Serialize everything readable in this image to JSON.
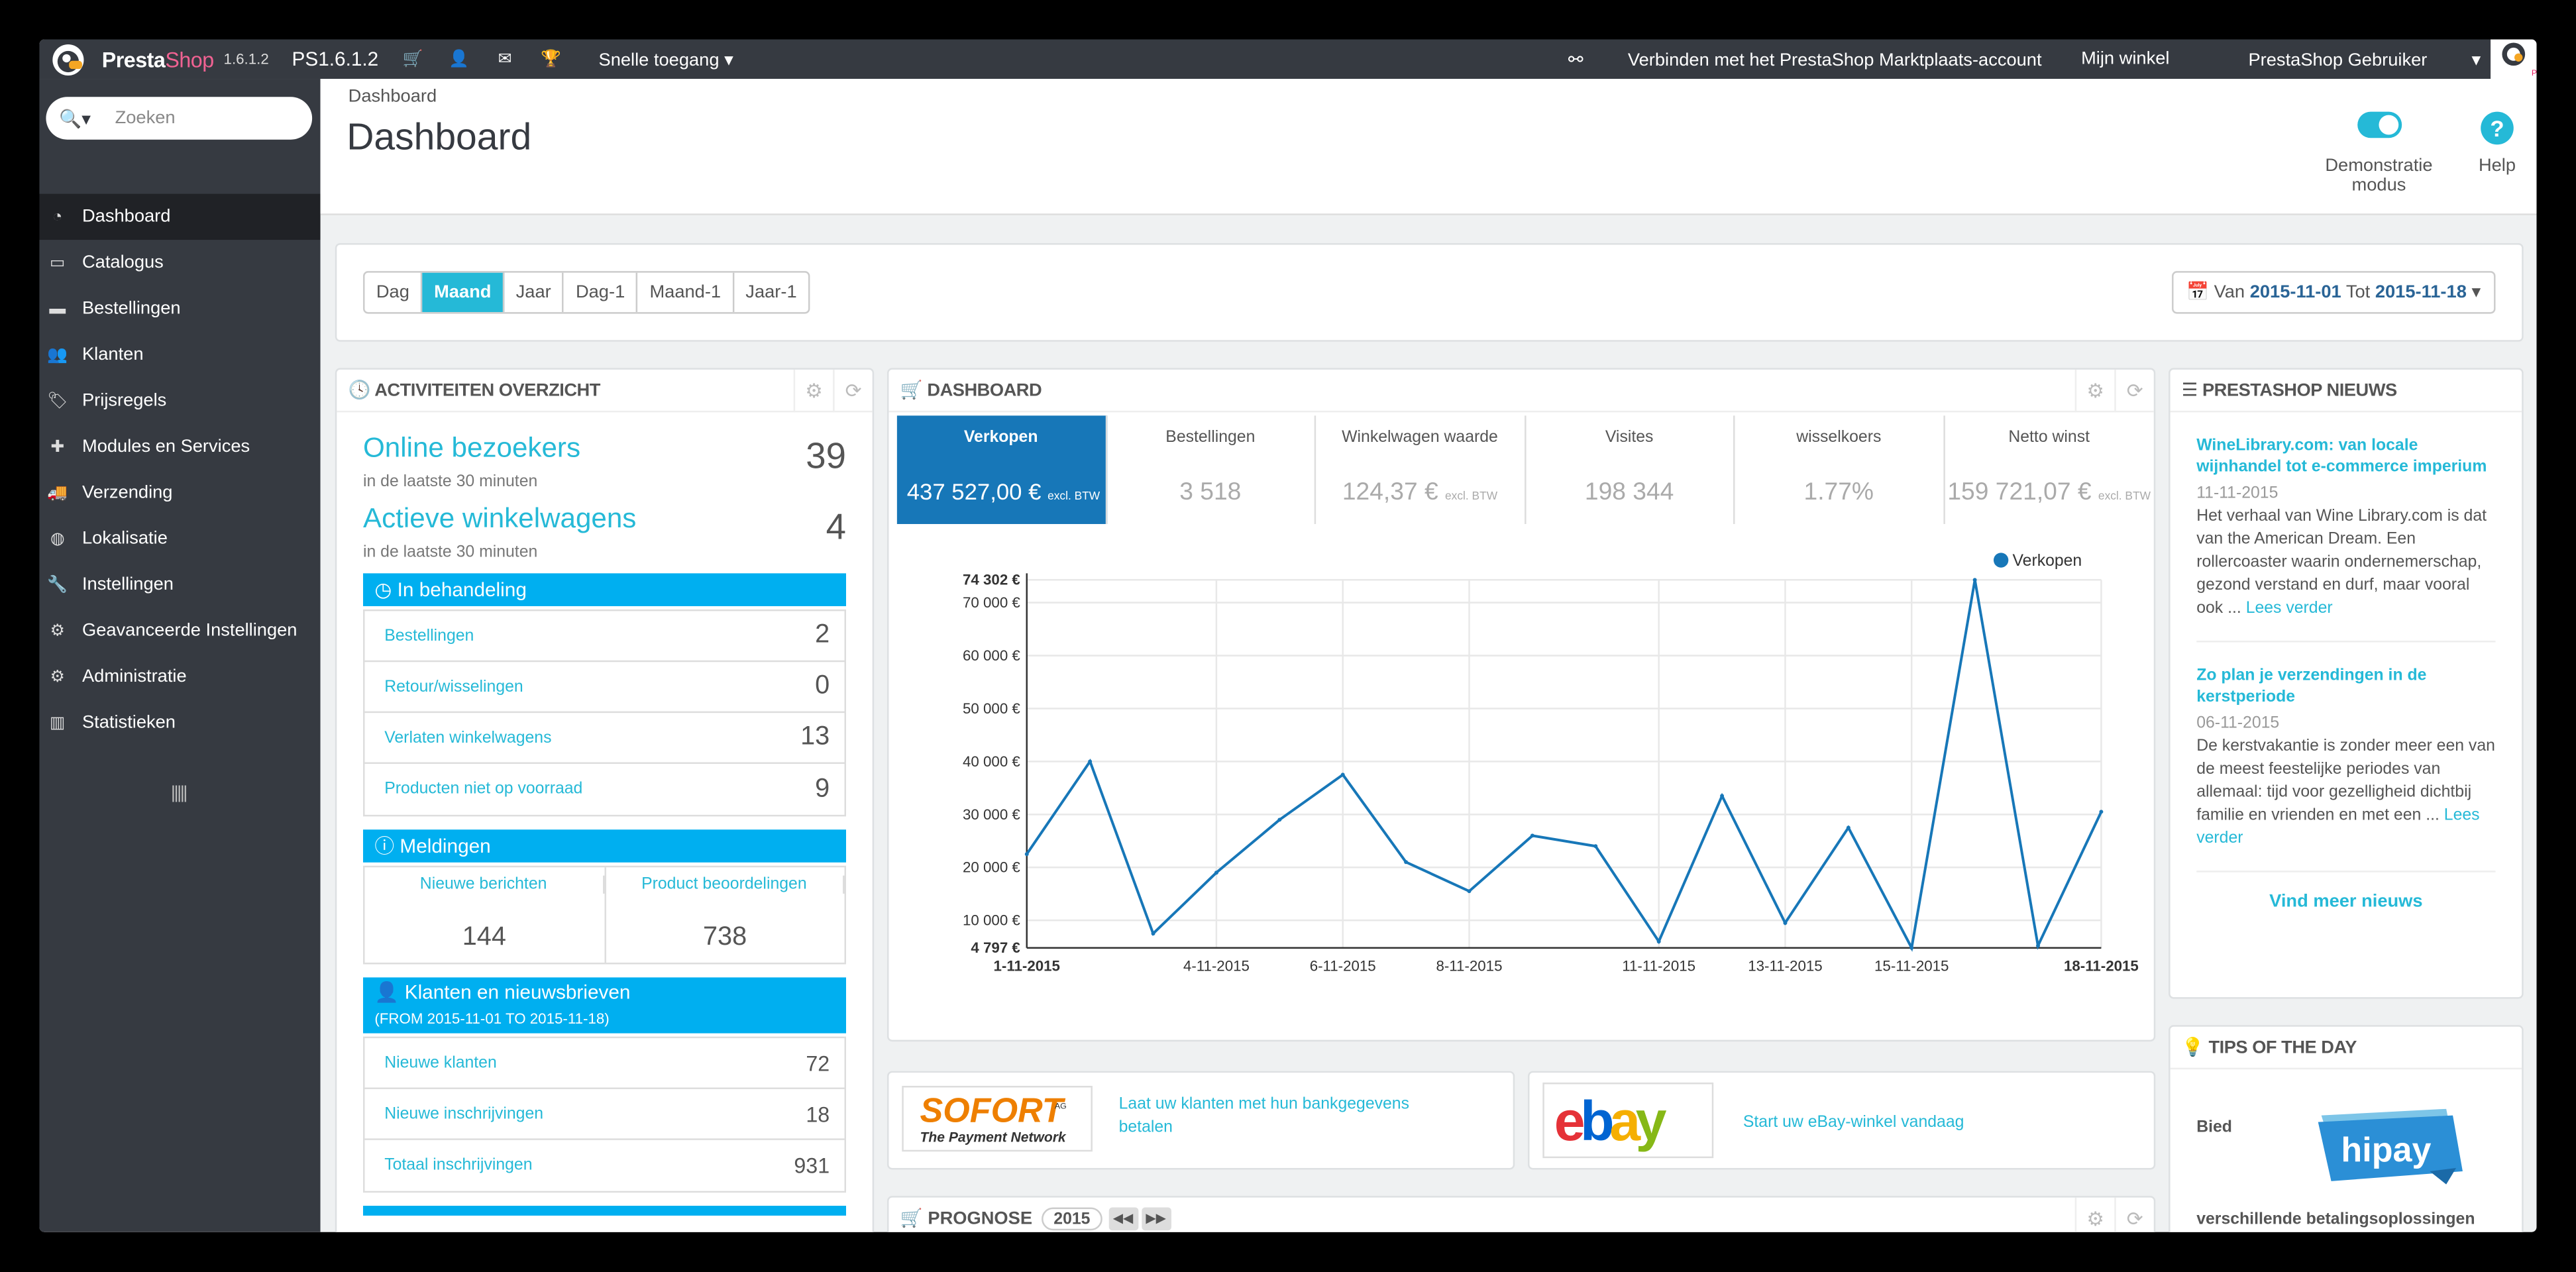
{
  "topbar": {
    "brand_a": "Presta",
    "brand_b": "Shop",
    "version": "1.6.1.2",
    "shop_name": "PS1.6.1.2",
    "quick_access": "Snelle toegang",
    "connect": "Verbinden met het PrestaShop Marktplaats-account",
    "my_shop": "Mijn winkel",
    "user": "PrestaShop Gebruiker",
    "avatar_text": "PrestaShop"
  },
  "sidebar": {
    "search_placeholder": "Zoeken",
    "items": [
      {
        "label": "Dashboard",
        "icon": "dashboard-icon"
      },
      {
        "label": "Catalogus",
        "icon": "catalog-icon"
      },
      {
        "label": "Bestellingen",
        "icon": "credit-card-icon"
      },
      {
        "label": "Klanten",
        "icon": "users-icon"
      },
      {
        "label": "Prijsregels",
        "icon": "tags-icon"
      },
      {
        "label": "Modules en Services",
        "icon": "puzzle-icon"
      },
      {
        "label": "Verzending",
        "icon": "truck-icon"
      },
      {
        "label": "Lokalisatie",
        "icon": "globe-icon"
      },
      {
        "label": "Instellingen",
        "icon": "wrench-icon"
      },
      {
        "label": "Geavanceerde Instellingen",
        "icon": "cogs-icon"
      },
      {
        "label": "Administratie",
        "icon": "gear-icon"
      },
      {
        "label": "Statistieken",
        "icon": "bar-chart-icon"
      }
    ],
    "collapse": "|||||"
  },
  "header": {
    "breadcrumb": "Dashboard",
    "title": "Dashboard",
    "demo_label": "Demonstratie modus",
    "help_label": "Help"
  },
  "period": {
    "buttons": [
      "Dag",
      "Maand",
      "Jaar",
      "Dag-1",
      "Maand-1",
      "Jaar-1"
    ],
    "active": "Maand",
    "van": "Van",
    "from": "2015-11-01",
    "tot": "Tot",
    "to": "2015-11-18"
  },
  "activity": {
    "title": "Activiteiten overzicht",
    "online_label": "Online bezoekers",
    "online_sub": "in de laatste 30 minuten",
    "online_value": "39",
    "carts_label": "Actieve winkelwagens",
    "carts_sub": "in de laatste 30 minuten",
    "carts_value": "4",
    "pending_title": "In behandeling",
    "pending": [
      {
        "label": "Bestellingen",
        "value": "2"
      },
      {
        "label": "Retour/wisselingen",
        "value": "0"
      },
      {
        "label": "Verlaten winkelwagens",
        "value": "13"
      },
      {
        "label": "Producten niet op voorraad",
        "value": "9"
      }
    ],
    "notif_title": "Meldingen",
    "notif_messages_label": "Nieuwe berichten",
    "notif_messages_value": "144",
    "notif_reviews_label": "Product beoordelingen",
    "notif_reviews_value": "738",
    "customers_title": "Klanten en nieuwsbrieven",
    "customers_sub": "(FROM 2015-11-01 TO 2015-11-18)",
    "customers": [
      {
        "label": "Nieuwe klanten",
        "value": "72"
      },
      {
        "label": "Nieuwe inschrijvingen",
        "value": "18"
      },
      {
        "label": "Totaal inschrijvingen",
        "value": "931"
      }
    ]
  },
  "dashboard": {
    "title": "Dashboard",
    "kpis": [
      {
        "label": "Verkopen",
        "value": "437 527,00 €",
        "suffix": "excl. BTW"
      },
      {
        "label": "Bestellingen",
        "value": "3 518",
        "suffix": ""
      },
      {
        "label": "Winkelwagen waarde",
        "value": "124,37 €",
        "suffix": "excl. BTW"
      },
      {
        "label": "Visites",
        "value": "198 344",
        "suffix": ""
      },
      {
        "label": "wisselkoers",
        "value": "1.77%",
        "suffix": ""
      },
      {
        "label": "Netto winst",
        "value": "159 721,07 €",
        "suffix": "excl. BTW"
      }
    ]
  },
  "chart_data": {
    "type": "line",
    "series": [
      {
        "name": "Verkopen",
        "color": "#1777b8",
        "x": [
          "1-11-2015",
          "2-11-2015",
          "3-11-2015",
          "4-11-2015",
          "5-11-2015",
          "6-11-2015",
          "7-11-2015",
          "8-11-2015",
          "9-11-2015",
          "10-11-2015",
          "11-11-2015",
          "12-11-2015",
          "13-11-2015",
          "14-11-2015",
          "15-11-2015",
          "16-11-2015",
          "17-11-2015",
          "18-11-2015"
        ],
        "values": [
          22500,
          40000,
          7500,
          19000,
          29000,
          37500,
          21000,
          15500,
          26000,
          24000,
          6000,
          33500,
          9500,
          27500,
          4800,
          74302,
          5200,
          30500
        ]
      }
    ],
    "x_tick_labels": [
      "1-11-2015",
      "4-11-2015",
      "6-11-2015",
      "8-11-2015",
      "11-11-2015",
      "13-11-2015",
      "15-11-2015",
      "18-11-2015"
    ],
    "y_tick_labels": [
      "74 302 €",
      "70 000 €",
      "60 000 €",
      "50 000 €",
      "40 000 €",
      "30 000 €",
      "20 000 €",
      "10 000 €",
      "4 797 €"
    ],
    "y_ticks": [
      74302,
      70000,
      60000,
      50000,
      40000,
      30000,
      20000,
      10000,
      4797
    ],
    "ylim": [
      4797,
      74302
    ],
    "legend_position": "top-right",
    "grid": true
  },
  "promos": {
    "sofort_logo": "SOFORT",
    "sofort_ag": "AG",
    "sofort_sub": "The Payment Network",
    "sofort_text_1": "Laat uw klanten met hun bankgegevens",
    "sofort_text_2": "betalen",
    "ebay_e": "e",
    "ebay_b": "b",
    "ebay_a": "a",
    "ebay_y": "y",
    "ebay_text": "Start uw eBay-winkel vandaag"
  },
  "prognose": {
    "title": "Prognose",
    "year": "2015"
  },
  "news": {
    "title": "PrestaShop Nieuws",
    "items": [
      {
        "title": "WineLibrary.com: van locale wijnhandel tot e-commerce imperium",
        "date": "11-11-2015",
        "text": "Het verhaal van Wine Library.com is dat van the American Dream. Een rollercoaster waarin ondernemerschap, gezond verstand en durf, maar vooral ook ...",
        "more": "Lees verder"
      },
      {
        "title": "Zo plan je verzendingen in de kerstperiode",
        "date": "06-11-2015",
        "text": "De kerstvakantie is zonder meer een van de meest feestelijke periodes van allemaal: tijd voor gezelligheid dichtbij familie en vrienden en met een ...",
        "more": "Lees verder"
      }
    ],
    "more_link": "Vind meer nieuws"
  },
  "tips": {
    "title": "Tips of the day",
    "line1": "Bied",
    "logo": "hipay",
    "line2": "verschillende betalingsoplossingen"
  }
}
